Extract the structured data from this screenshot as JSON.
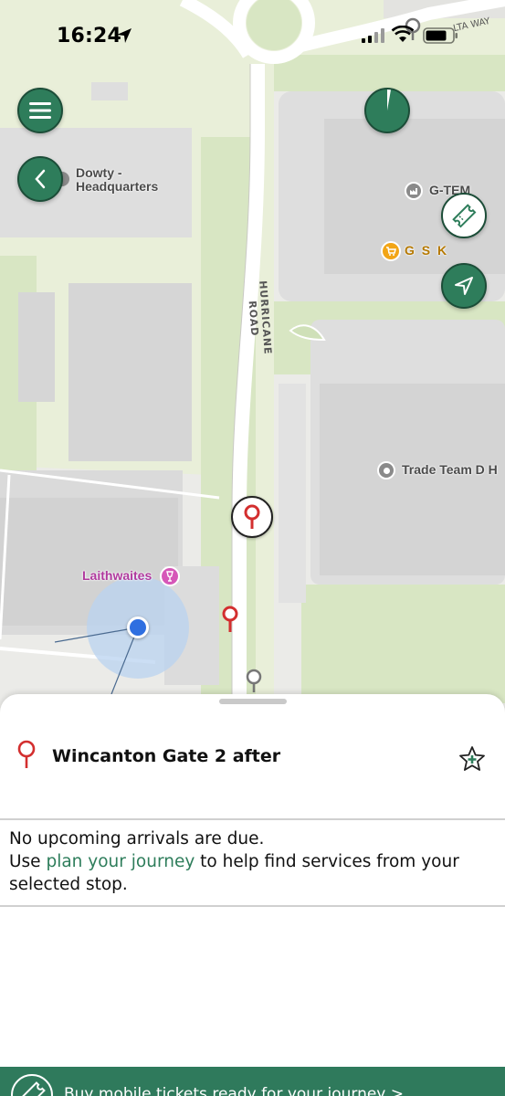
{
  "status_bar": {
    "time": "16:24"
  },
  "map": {
    "road_label": "HURRICANE ROAD",
    "top_road_label": "LTA WAY",
    "places": [
      {
        "name": "Dowty - Headquarters",
        "line1": "Dowty -",
        "line2": "Headquarters"
      },
      {
        "name": "G-TEM"
      },
      {
        "name": "G S K"
      },
      {
        "name": "Trade Team D H"
      },
      {
        "name": "Laithwaites"
      }
    ],
    "icons": {
      "menu": "menu-icon",
      "back": "chevron-left-icon",
      "ticket": "ticket-icon",
      "locate": "navigation-arrow-icon",
      "timer": "refresh-timer-icon"
    },
    "accent_color": "#2e7d5b",
    "pin_color": "#d32f2f",
    "user_location_color": "#2f6fe0"
  },
  "sheet": {
    "stop_name": "Wincanton Gate 2 after",
    "message_line1": "No upcoming arrivals are due.",
    "message_prefix": "Use ",
    "message_link": "plan your journey",
    "message_suffix": " to help find services from your selected stop."
  },
  "banner": {
    "text": "Buy mobile tickets ready for your journey >"
  }
}
